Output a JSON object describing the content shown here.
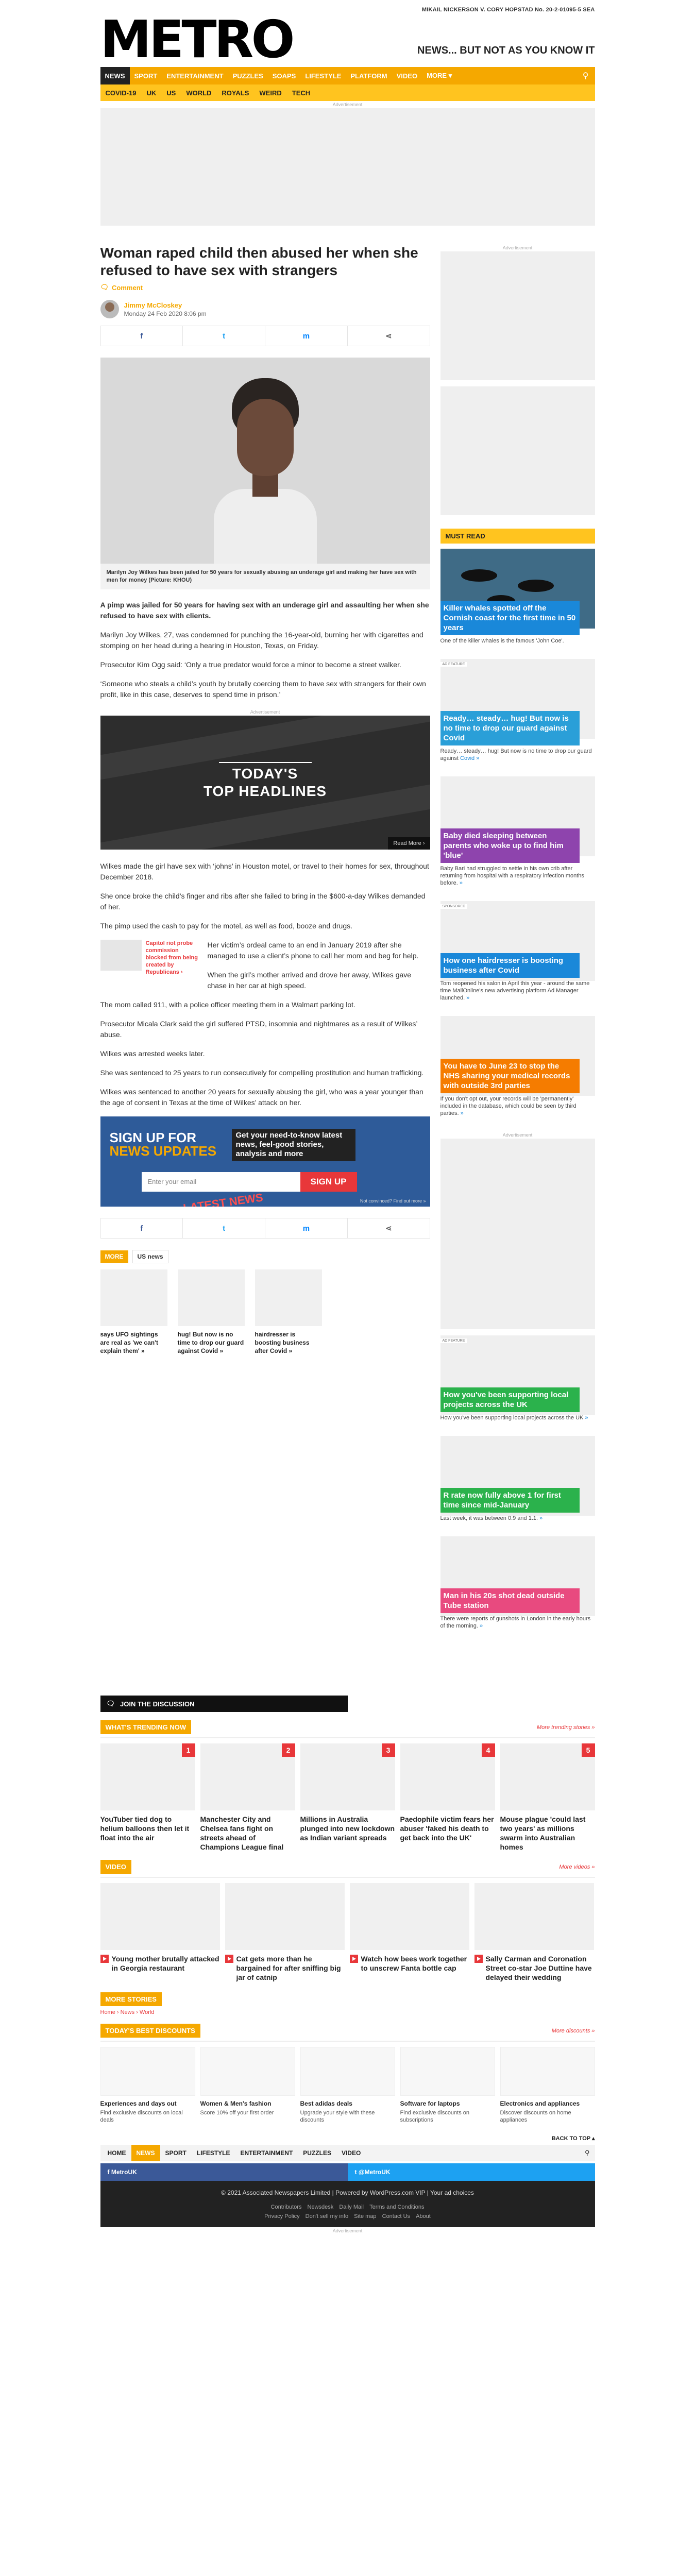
{
  "topline": "MIKAIL NICKERSON V. CORY HOPSTAD No. 20-2-01095-5 SEA",
  "brand": {
    "logo": "METRO",
    "tagline": "NEWS... BUT NOT AS YOU KNOW IT"
  },
  "nav_primary": [
    "NEWS",
    "SPORT",
    "ENTERTAINMENT",
    "PUZZLES",
    "SOAPS",
    "LIFESTYLE",
    "PLATFORM",
    "VIDEO",
    "MORE ▾"
  ],
  "nav_secondary": [
    "COVID-19",
    "UK",
    "US",
    "WORLD",
    "ROYALS",
    "WEIRD",
    "TECH"
  ],
  "ad_label": "Advertisement",
  "article": {
    "headline": "Woman raped child then abused her when she refused to have sex with strangers",
    "comment_label": "Comment",
    "author": "Jimmy McCloskey",
    "date": "Monday 24 Feb 2020 8:06 pm",
    "caption": "Marilyn Joy Wilkes has been jailed for 50 years for sexually abusing an underage girl and making her have sex with men for money (Picture: KHOU)",
    "lead": "A pimp was jailed for 50 years for having sex with an underage girl and assaulting her when she refused to have sex with clients.",
    "paras1": [
      "Marilyn Joy Wilkes, 27, was condemned for punching the 16-year-old, burning her with cigarettes and stomping on her head during a hearing in Houston, Texas, on Friday.",
      "Prosecutor Kim Ogg said: ‘Only a true predator would force a minor to become a street walker.",
      "‘Someone who steals a child’s youth by brutally coercing them to have sex with strangers for their own profit, like in this case, deserves to spend time in prison.’"
    ],
    "promo_title": "TODAY'S\nTOP HEADLINES",
    "promo_readmore": "Read More ›",
    "paras2": [
      "Wilkes made the girl have sex with ‘johns’ in Houston motel, or travel to their homes for sex, throughout December 2018.",
      "She once broke the child’s finger and ribs after she failed to bring in the $600-a-day Wilkes demanded of her.",
      "The pimp used the cash to pay for the motel, as well as food, booze and drugs."
    ],
    "pull_text": "Capitol riot probe commission blocked from being created by Republicans ›",
    "paras3": [
      "Her victim’s ordeal came to an end in January 2019 after she managed to use a client’s phone to call her mom and beg for help.",
      "When the girl’s mother arrived and drove her away, Wilkes gave chase in her car at high speed.",
      "The mom called 911, with a police officer meeting them in a Walmart parking lot.",
      "Prosecutor Micala Clark said the girl suffered PTSD, insomnia and nightmares as a result of Wilkes’ abuse.",
      "Wilkes was arrested weeks later.",
      "She was sentenced to 25 years to run consecutively for compelling prostitution and human trafficking.",
      "Wilkes was sentenced to another 20 years for sexually abusing the girl, who was a year younger than the age of consent in Texas at the time of Wilkes’ attack on her."
    ]
  },
  "signup": {
    "headline1": "SIGN UP FOR",
    "headline2": "NEWS UPDATES",
    "sub": "Get your need-to-know latest news, feel-good stories, analysis and more",
    "placeholder": "Enter your email",
    "button": "SIGN UP",
    "badge": "LATEST NEWS",
    "fine": "Not convinced? Find out more »"
  },
  "share": {
    "facebook": "f",
    "twitter": "t",
    "messenger": "m",
    "share": "⋖"
  },
  "more": {
    "label": "MORE",
    "tag": "US news",
    "items": [
      "says UFO sightings are real as 'we can't explain them' »",
      "hug! But now is no time to drop our guard against Covid »",
      "hairdresser is boosting business after Covid »"
    ]
  },
  "sidebar": {
    "mustread": "MUST READ",
    "items": [
      {
        "headline": "Killer whales spotted off the Cornish coast for the first time in 50 years",
        "desc": "One of the killer whales is the famous 'John Coe'.",
        "color": "c-blue",
        "label": ""
      },
      {
        "headline": "Ready… steady… hug! But now is no time to drop our guard against Covid",
        "desc": "Ready… steady… hug! But now is no time to drop our guard against ",
        "link": "Covid »",
        "color": "c-teal",
        "label": "AD FEATURE"
      },
      {
        "headline": "Baby died sleeping between parents who woke up to find him 'blue'",
        "desc": "Baby Bari had struggled to settle in his own crib after returning from hospital with a respiratory infection months before.",
        "link": "»",
        "color": "c-purple",
        "label": ""
      },
      {
        "headline": "How one hairdresser is boosting business after Covid",
        "desc": "Tom reopened his salon in April this year - around the same time MailOnline's new advertising platform Ad Manager launched.",
        "link": "»",
        "color": "c-blue",
        "label": "SPONSORED"
      },
      {
        "headline": "You have to June 23 to stop the NHS sharing your medical records with outside 3rd parties",
        "desc": "If you don't opt out, your records will be 'permanently' included in the database, which could be seen by third parties.",
        "link": "»",
        "color": "c-orange",
        "label": ""
      },
      {
        "headline": "How you've been supporting local projects across the UK",
        "desc": "How you've been supporting local projects across the UK",
        "link": "»",
        "color": "c-green",
        "label": "AD FEATURE"
      },
      {
        "headline": "R rate now fully above 1 for first time since mid-January",
        "desc": "Last week, it was between 0.9 and 1.1.",
        "link": "»",
        "color": "c-green",
        "label": ""
      },
      {
        "headline": "Man in his 20s shot dead outside Tube station",
        "desc": "There were reports of gunshots in London in the early hours of the morning.",
        "link": "»",
        "color": "c-pink",
        "label": ""
      }
    ]
  },
  "discussion": "JOIN THE DISCUSSION",
  "trending": {
    "label": "WHAT'S TRENDING NOW",
    "more": "More trending stories »",
    "items": [
      {
        "n": "1",
        "t": "YouTuber tied dog to helium balloons then let it float into the air"
      },
      {
        "n": "2",
        "t": "Manchester City and Chelsea fans fight on streets ahead of Champions League final"
      },
      {
        "n": "3",
        "t": "Millions in Australia plunged into new lockdown as Indian variant spreads"
      },
      {
        "n": "4",
        "t": "Paedophile victim fears her abuser 'faked his death to get back into the UK'"
      },
      {
        "n": "5",
        "t": "Mouse plague 'could last two years' as millions swarm into Australian homes"
      }
    ]
  },
  "video": {
    "label": "VIDEO",
    "more": "More videos »",
    "items": [
      "Young mother brutally attacked in Georgia restaurant",
      "Cat gets more than he bargained for after sniffing big jar of catnip",
      "Watch how bees work together to unscrew Fanta bottle cap",
      "Sally Carman and Coronation Street co-star Joe Duttine have delayed their wedding"
    ]
  },
  "more_stories": {
    "label": "MORE STORIES",
    "crumbs": "Home › News › World"
  },
  "discounts": {
    "label": "TODAY'S BEST DISCOUNTS",
    "more": "More discounts »",
    "items": [
      {
        "t": "Experiences and days out",
        "d": "Find exclusive discounts on local deals"
      },
      {
        "t": "Women & Men's fashion",
        "d": "Score 10% off your first order"
      },
      {
        "t": "Best adidas deals",
        "d": "Upgrade your style with these discounts"
      },
      {
        "t": "Software for laptops",
        "d": "Find exclusive discounts on subscriptions"
      },
      {
        "t": "Electronics and appliances",
        "d": "Discover discounts on home appliances"
      }
    ]
  },
  "backtop": "BACK TO TOP ▴",
  "footer_nav": [
    "HOME",
    "NEWS",
    "SPORT",
    "LIFESTYLE",
    "ENTERTAINMENT",
    "PUZZLES",
    "VIDEO"
  ],
  "social": {
    "facebook": "f  MetroUK",
    "twitter": "t  @MetroUK"
  },
  "footer": {
    "copy": "© 2021 Associated Newspapers Limited  |  Powered by WordPress.com VIP  |  Your ad choices",
    "links": [
      "Contributors",
      "Newsdesk",
      "Daily Mail",
      "Terms and Conditions",
      "Privacy Policy",
      "Don't sell my info",
      "Site map",
      "Contact Us",
      "About"
    ]
  }
}
